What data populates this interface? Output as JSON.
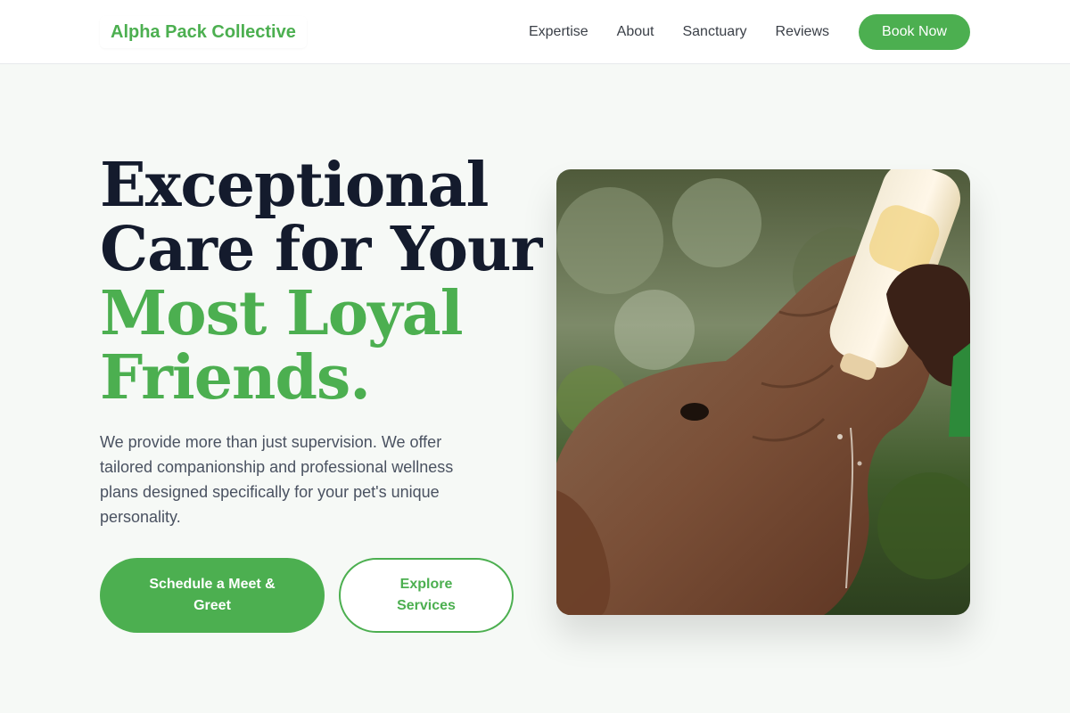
{
  "brand": {
    "name": "Alpha Pack Collective"
  },
  "nav": {
    "links": [
      "Expertise",
      "About",
      "Sanctuary",
      "Reviews"
    ],
    "cta": "Book Now"
  },
  "hero": {
    "title_lines": [
      "Exceptional",
      "Care for Your"
    ],
    "title_highlight_lines": [
      "Most Loyal",
      "Friends."
    ],
    "subtitle": "We provide more than just supervision. We offer tailored companionship and professional wellness plans designed specifically for your pet's unique personality.",
    "primary_cta": "Schedule a Meet & Greet",
    "secondary_cta": "Explore Services",
    "image_subject": "elephant-calf-bottle-feeding"
  },
  "colors": {
    "accent": "#4caf50",
    "heading": "#141b2d",
    "body_text": "#4a5261",
    "background": "#f6f9f6"
  }
}
